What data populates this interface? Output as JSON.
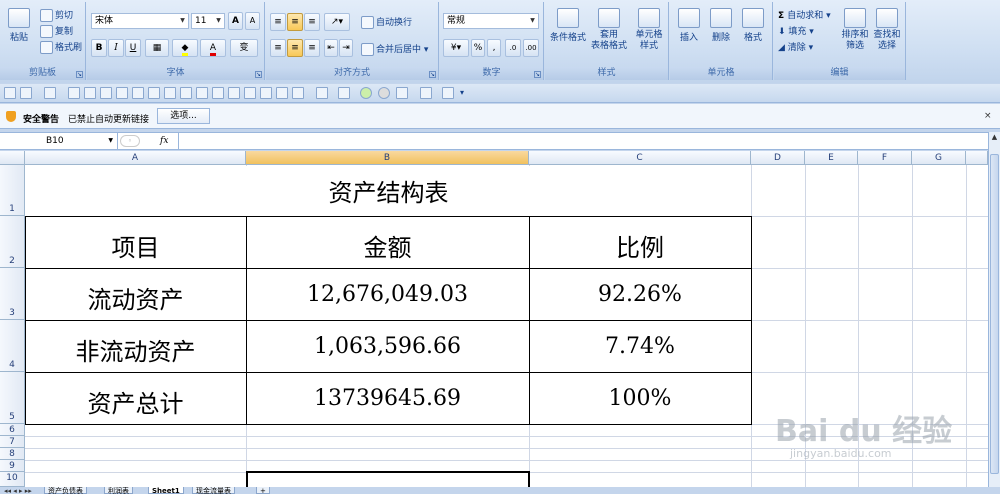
{
  "ribbon": {
    "clipboard": {
      "paste": "粘贴",
      "cut": "剪切",
      "copy": "复制",
      "format_painter": "格式刷",
      "label": "剪贴板"
    },
    "font": {
      "name": "宋体",
      "size": "11",
      "grow": "A",
      "shrink": "A",
      "bold": "B",
      "italic": "I",
      "underline": "U",
      "label": "字体",
      "font_color": "A",
      "phonetic": "变"
    },
    "alignment": {
      "wrap_text": "自动换行",
      "merge_center": "合并后居中",
      "label": "对齐方式"
    },
    "number": {
      "format": "常规",
      "percent": "%",
      "comma": ",",
      "label": "数字"
    },
    "styles": {
      "conditional": "条件格式",
      "table_format_1": "套用",
      "table_format_2": "表格格式",
      "cell_styles_1": "单元格",
      "cell_styles_2": "样式",
      "label": "样式"
    },
    "cells": {
      "insert": "插入",
      "delete": "删除",
      "format": "格式",
      "label": "单元格"
    },
    "editing": {
      "autosum": "自动求和",
      "fill": "填充",
      "clear": "清除",
      "sort_filter_1": "排序和",
      "sort_filter_2": "筛选",
      "find_select_1": "查找和",
      "find_select_2": "选择",
      "label": "编辑"
    }
  },
  "security": {
    "title": "安全警告",
    "message": "已禁止自动更新链接",
    "options": "选项..."
  },
  "formula_bar": {
    "name_box": "B10",
    "fx": "fx",
    "value": ""
  },
  "columns": [
    "A",
    "B",
    "C",
    "D",
    "E",
    "F",
    "G"
  ],
  "rows": [
    "1",
    "2",
    "3",
    "4",
    "5",
    "6",
    "7",
    "8",
    "9",
    "10"
  ],
  "sheet": {
    "title": "资产结构表",
    "headers": [
      "项目",
      "金额",
      "比例"
    ],
    "rows": [
      [
        "流动资产",
        "12,676,049.03",
        "92.26%"
      ],
      [
        "非流动资产",
        "1,063,596.66",
        "7.74%"
      ],
      [
        "资产总计",
        "13739645.69",
        "100%"
      ]
    ]
  },
  "tabs": [
    "资产负债表",
    "利润表",
    "Sheet1",
    "现金流量表"
  ],
  "watermark": {
    "brand": "Bai du 经验",
    "url": "jingyan.baidu.com"
  },
  "colors": {
    "accent": "#f1c15f",
    "ribbon": "#cfdff2",
    "grid": "#d0d7e5"
  }
}
